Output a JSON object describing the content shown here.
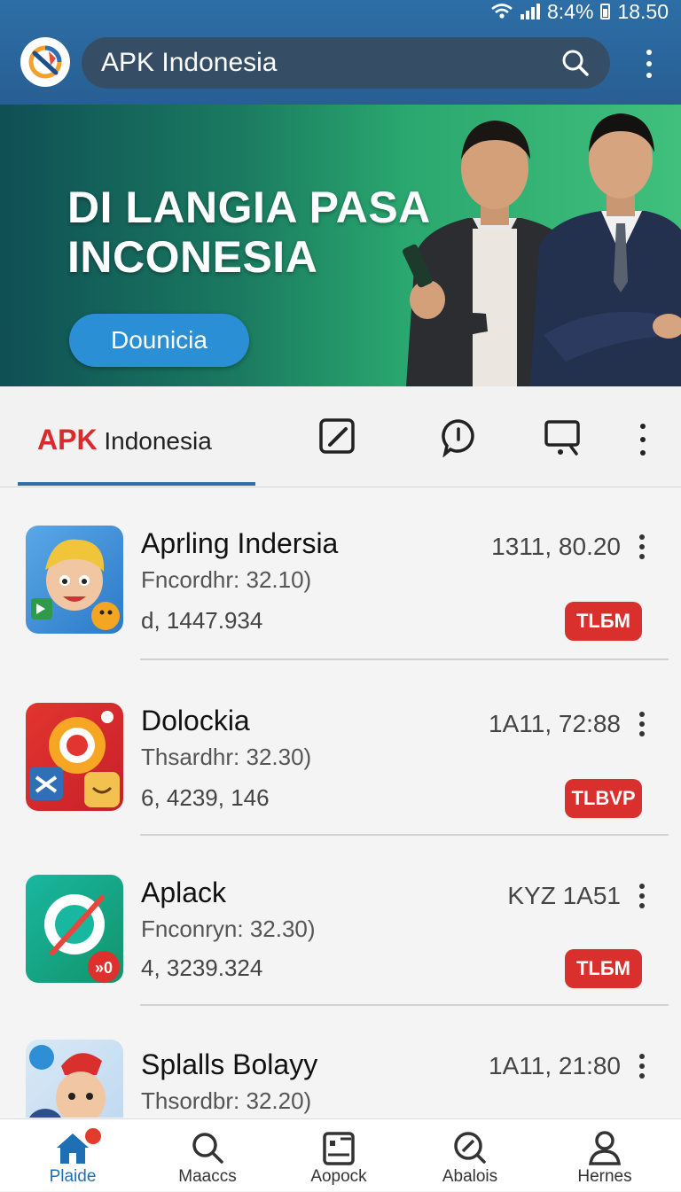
{
  "status_bar": {
    "battery": "8:4%",
    "time": "18.50"
  },
  "header": {
    "search_title": "APK Indonesia"
  },
  "banner": {
    "headline_line1": "DI LANGIA PASA",
    "headline_line2": "INCONESIA",
    "button": "Dounicia"
  },
  "tabs": {
    "brand_prefix": "APK",
    "brand_suffix": " Indonesia",
    "icons": [
      "edit-icon",
      "chat-icon",
      "screen-icon"
    ]
  },
  "apps": [
    {
      "name": "Aprling Indersia",
      "subtitle": "Fncordhr: 32.10)",
      "meta": "d, 1447.934",
      "value": "1311, 80.20",
      "badge": "TLБM"
    },
    {
      "name": "Dolockia",
      "subtitle": "Thsardhr: 32.30)",
      "meta": "6, 4239, 146",
      "value": "1A11, 72:88",
      "badge": "TLBVP"
    },
    {
      "name": "Aplack",
      "subtitle": "Fnconryn: 32.30)",
      "meta": "4, 3239.324",
      "value": "KYZ 1A51",
      "badge": "TLБM"
    },
    {
      "name": "Splalls Bolayy",
      "subtitle": "Thsordbr: 32.20)",
      "meta": "",
      "value": "1A11, 21:80",
      "badge": ""
    }
  ],
  "bottom_nav": [
    {
      "label": "Plaide",
      "icon": "home-icon"
    },
    {
      "label": "Maaccs",
      "icon": "search-icon"
    },
    {
      "label": "Aopock",
      "icon": "clipboard-icon"
    },
    {
      "label": "Abalois",
      "icon": "compass-icon"
    },
    {
      "label": "Hernes",
      "icon": "profile-icon"
    }
  ],
  "colors": {
    "header": "#2d6ea6",
    "accent": "#1f6fb5",
    "badge": "#d9302e"
  }
}
